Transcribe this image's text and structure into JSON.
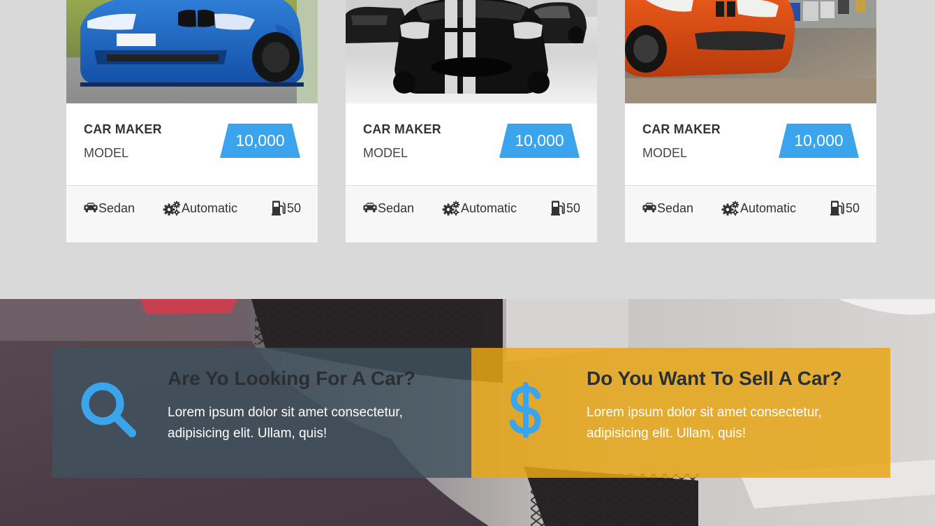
{
  "colors": {
    "accent_blue": "#3aa5ed",
    "promo_dark": "#40525e",
    "promo_yellow": "#e8a616",
    "page_bg": "#d9d9d9"
  },
  "listings": [
    {
      "maker": "CAR MAKER",
      "model": "MODEL",
      "price": "10,000",
      "body_type": "Sedan",
      "transmission": "Automatic",
      "fuel": "50",
      "image": "blue-bmw-car-photo",
      "icons": [
        "car-icon",
        "cogs-icon",
        "gas-pump-icon"
      ]
    },
    {
      "maker": "CAR MAKER",
      "model": "MODEL",
      "price": "10,000",
      "body_type": "Sedan",
      "transmission": "Automatic",
      "fuel": "50",
      "image": "black-striped-sports-car-photo",
      "icons": [
        "car-icon",
        "cogs-icon",
        "gas-pump-icon"
      ]
    },
    {
      "maker": "CAR MAKER",
      "model": "MODEL",
      "price": "10,000",
      "body_type": "Sedan",
      "transmission": "Automatic",
      "fuel": "50",
      "image": "orange-bmw-car-photo",
      "icons": [
        "car-icon",
        "cogs-icon",
        "gas-pump-icon"
      ]
    }
  ],
  "promo": {
    "background_image": "car-grille-on-asphalt-photo",
    "buy": {
      "title": "Are Yo Looking For A Car?",
      "text": "Lorem ipsum dolor sit amet consectetur, adipisicing elit. Ullam, quis!",
      "icon": "search-icon"
    },
    "sell": {
      "title": "Do You Want To Sell A Car?",
      "text": "Lorem ipsum dolor sit amet consectetur, adipisicing elit. Ullam, quis!",
      "icon": "dollar-icon"
    }
  }
}
